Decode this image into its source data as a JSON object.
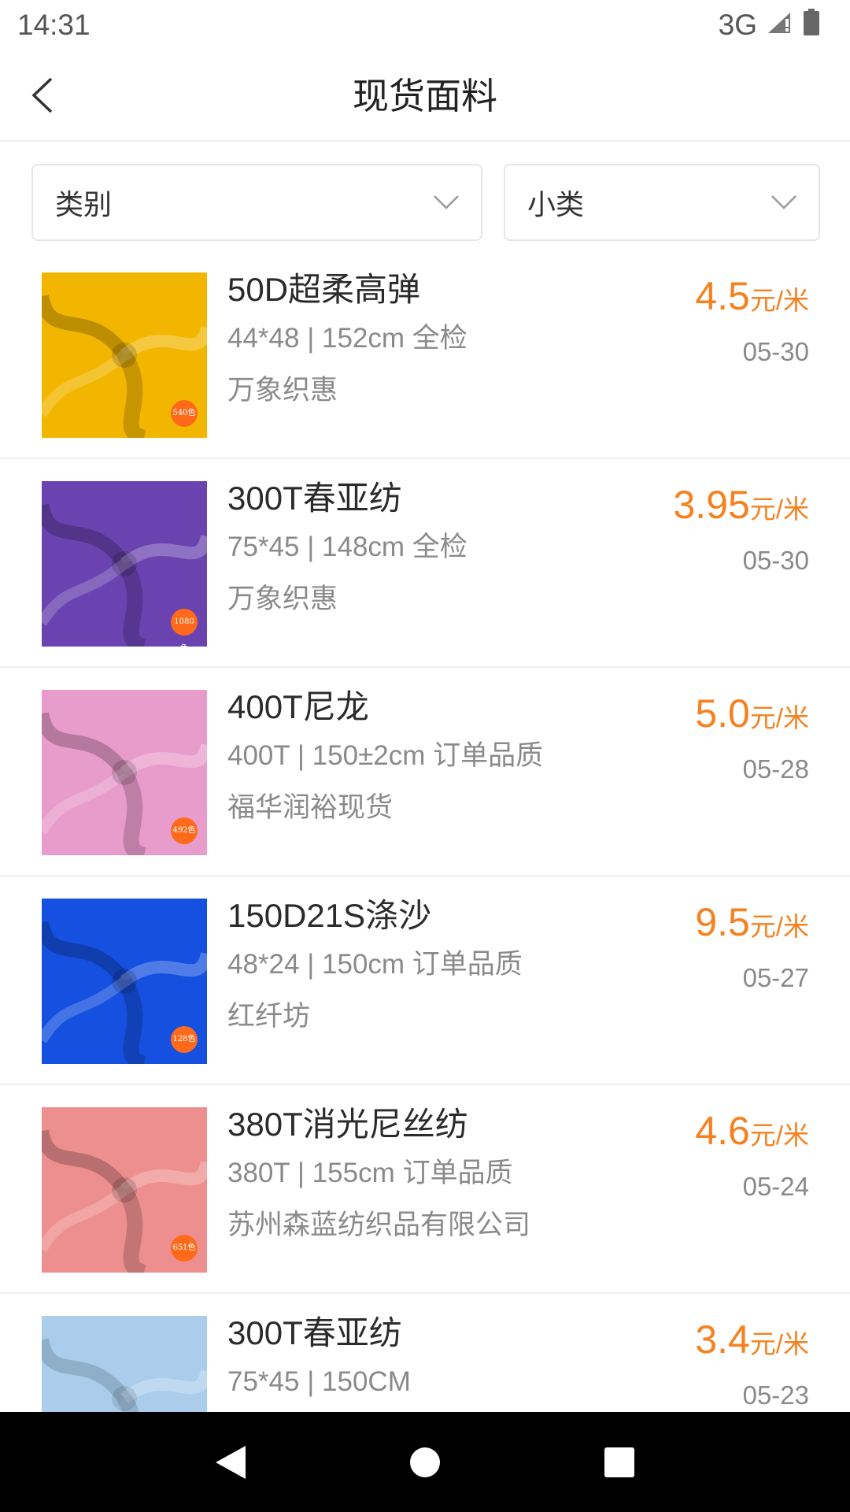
{
  "status_bar": {
    "time": "14:31",
    "network": "3G"
  },
  "header": {
    "title": "现货面料"
  },
  "filters": [
    {
      "label": "类别"
    },
    {
      "label": "小类"
    }
  ],
  "items": [
    {
      "name": "50D超柔高弹",
      "spec": "44*48 | 152cm 全检",
      "supplier": "万象织惠",
      "price": "4.5",
      "unit": "元/米",
      "date": "05-30",
      "badge": "540色",
      "color": "#f2b600"
    },
    {
      "name": "300T春亚纺",
      "spec": "75*45 | 148cm 全检",
      "supplier": "万象织惠",
      "price": "3.95",
      "unit": "元/米",
      "date": "05-30",
      "badge": "1080色",
      "color": "#6a43b0"
    },
    {
      "name": "400T尼龙",
      "spec": "400T | 150±2cm 订单品质",
      "supplier": "福华润裕现货",
      "price": "5.0",
      "unit": "元/米",
      "date": "05-28",
      "badge": "492色",
      "color": "#e89ccb"
    },
    {
      "name": "150D21S涤沙",
      "spec": "48*24 | 150cm 订单品质",
      "supplier": "红纤坊",
      "price": "9.5",
      "unit": "元/米",
      "date": "05-27",
      "badge": "128色",
      "color": "#1650e0"
    },
    {
      "name": "380T消光尼丝纺",
      "spec": "380T | 155cm 订单品质",
      "supplier": "苏州森蓝纺织品有限公司",
      "price": "4.6",
      "unit": "元/米",
      "date": "05-24",
      "badge": "651色",
      "color": "#ee8f8f"
    },
    {
      "name": "300T春亚纺",
      "spec": "75*45 | 150CM",
      "supplier": "",
      "price": "3.4",
      "unit": "元/米",
      "date": "05-23",
      "badge": "",
      "color": "#a9cdeb"
    }
  ]
}
